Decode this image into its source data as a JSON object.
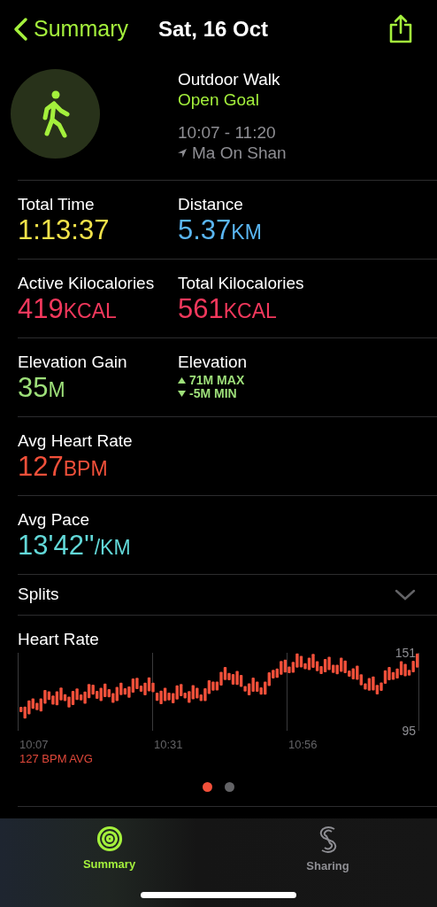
{
  "nav": {
    "back": "Summary",
    "title": "Sat, 16 Oct"
  },
  "workout": {
    "type": "Outdoor Walk",
    "goal": "Open Goal",
    "time": "10:07 - 11:20",
    "location": "Ma On Shan"
  },
  "stats": [
    [
      {
        "kind": "metric",
        "label": "Total Time",
        "value": "1:13:37",
        "color": "#f2e24a"
      },
      {
        "kind": "metric",
        "label": "Distance",
        "value": "5.37",
        "unit": "KM",
        "color": "#5ab6f2"
      }
    ],
    [
      {
        "kind": "metric",
        "label": "Active Kilocalories",
        "value": "419",
        "unit": "KCAL",
        "color": "#f2385c"
      },
      {
        "kind": "metric",
        "label": "Total Kilocalories",
        "value": "561",
        "unit": "KCAL",
        "color": "#f2385c"
      }
    ],
    [
      {
        "kind": "metric",
        "label": "Elevation Gain",
        "value": "35",
        "unit": "M",
        "color": "#9ee07a"
      },
      {
        "kind": "range",
        "label": "Elevation",
        "max": "71M MAX",
        "min": "-5M MIN",
        "color": "#9ee07a"
      }
    ],
    [
      {
        "kind": "metric",
        "label": "Avg Heart Rate",
        "value": "127",
        "unit": "BPM",
        "color": "#f2503a"
      }
    ],
    [
      {
        "kind": "metric",
        "label": "Avg Pace",
        "value": "13'42''",
        "unit": "/KM",
        "color": "#62d8d8"
      }
    ]
  ],
  "splits": {
    "label": "Splits",
    "expanded": false
  },
  "heart_rate": {
    "title": "Heart Rate",
    "x_labels": [
      "10:07",
      "10:31",
      "10:56"
    ],
    "max": "151",
    "min": "95",
    "average": "127 BPM AVG"
  },
  "pager": [
    {
      "selected": true
    },
    {
      "selected": false
    }
  ],
  "tabs": [
    {
      "kind": "rings",
      "label": "Summary",
      "selected": true
    },
    {
      "kind": "sharing",
      "label": "Sharing",
      "selected": false
    }
  ]
}
